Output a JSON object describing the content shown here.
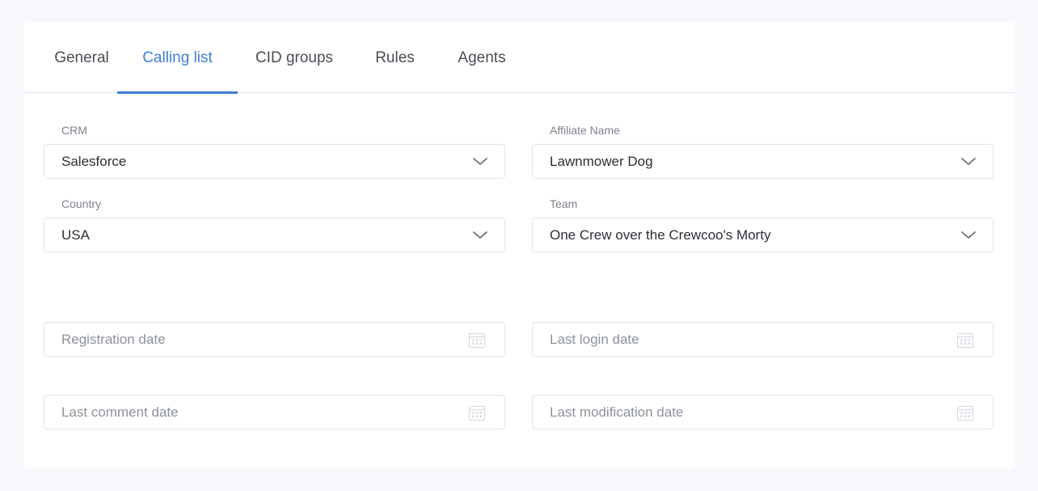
{
  "tabs": [
    {
      "label": "General",
      "active": false
    },
    {
      "label": "Calling list",
      "active": true
    },
    {
      "label": "CID groups",
      "active": false
    },
    {
      "label": "Rules",
      "active": false
    },
    {
      "label": "Agents",
      "active": false
    }
  ],
  "form": {
    "crm": {
      "label": "CRM",
      "value": "Salesforce"
    },
    "affiliate": {
      "label": "Affiliate Name",
      "value": "Lawnmower Dog"
    },
    "country": {
      "label": "Country",
      "value": "USA"
    },
    "team": {
      "label": "Team",
      "value": "One Crew over the Crewcoo's Morty"
    },
    "registration_date": {
      "placeholder": "Registration date"
    },
    "last_login_date": {
      "placeholder": "Last login date"
    },
    "last_comment_date": {
      "placeholder": "Last comment date"
    },
    "last_modification_date": {
      "placeholder": "Last modification date"
    }
  },
  "icons": {
    "select": "chevron-down-icon",
    "date": "calendar-icon"
  },
  "colors": {
    "accent": "#3d7fd6",
    "background": "#f7f8fc",
    "border": "#dfe6ee"
  }
}
